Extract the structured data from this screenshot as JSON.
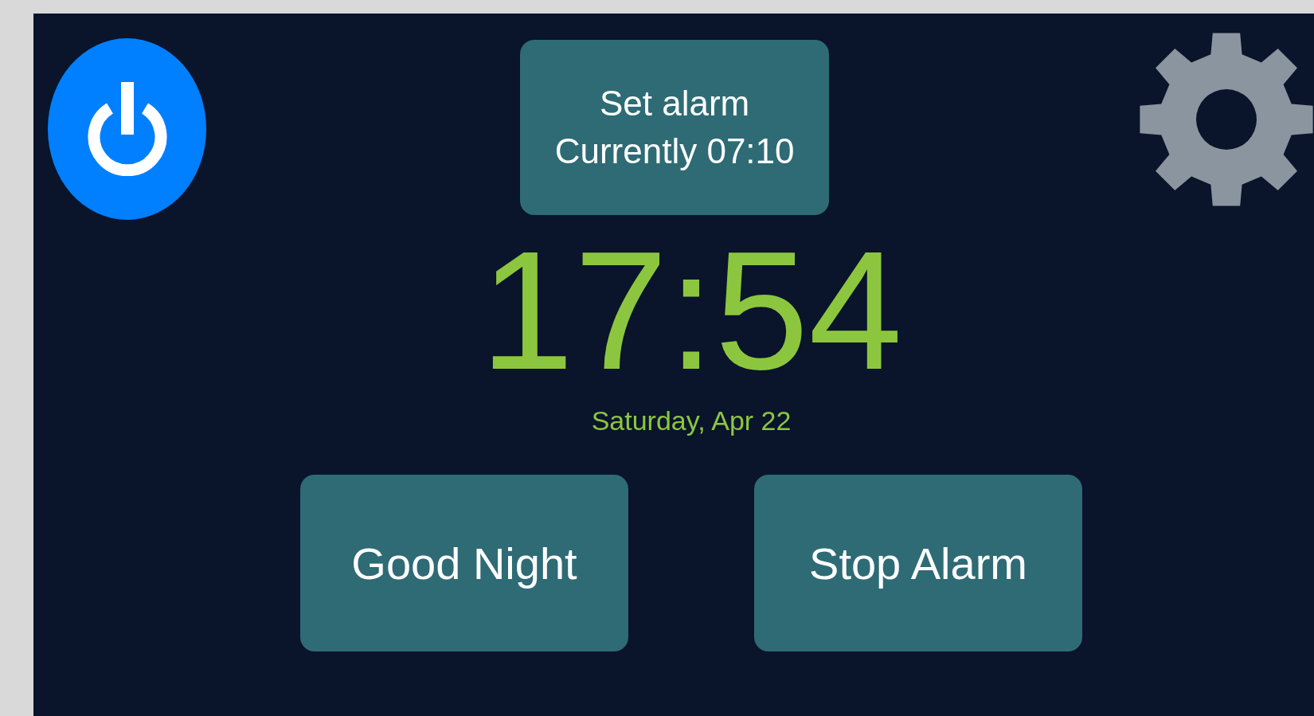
{
  "alarm_button": {
    "title": "Set alarm",
    "subtitle": "Currently 07:10"
  },
  "clock": {
    "time": "17:54",
    "date": "Saturday, Apr 22"
  },
  "buttons": [
    "Good Night",
    "Stop Alarm"
  ]
}
